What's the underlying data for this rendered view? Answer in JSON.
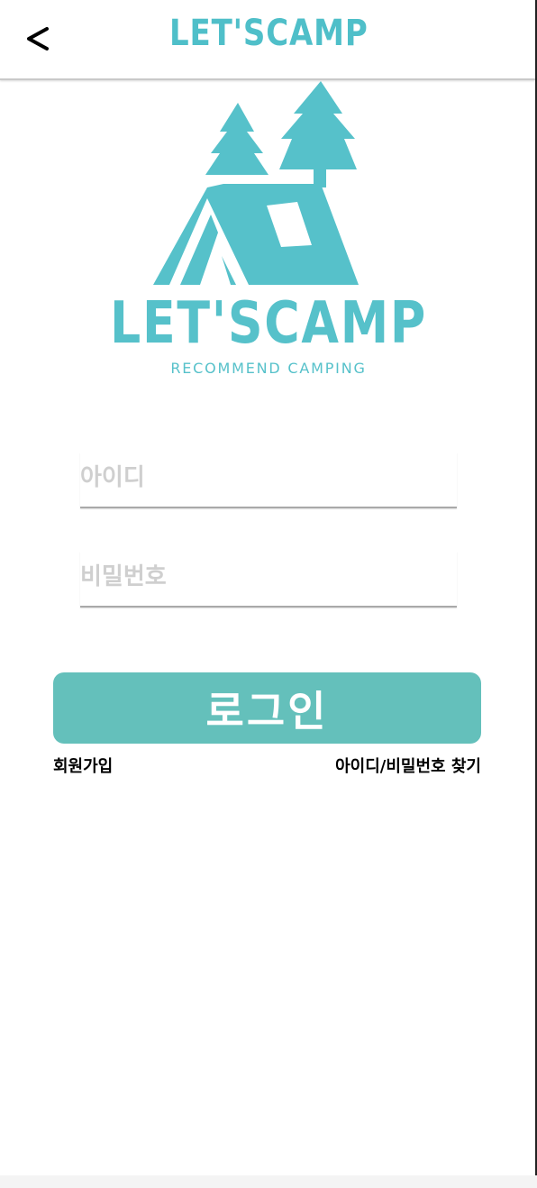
{
  "header": {
    "back_label": "<",
    "title": "LET'SCAMP"
  },
  "logo": {
    "wordmark": "LET'SCAMP",
    "tagline": "RECOMMEND CAMPING",
    "color": "#56c1ca"
  },
  "form": {
    "id_placeholder": "아이디",
    "password_placeholder": "비밀번호",
    "login_label": "로그인",
    "login_color": "#64c0bb"
  },
  "links": {
    "signup": "회원가입",
    "find_account": "아이디/비밀번호 찾기"
  }
}
